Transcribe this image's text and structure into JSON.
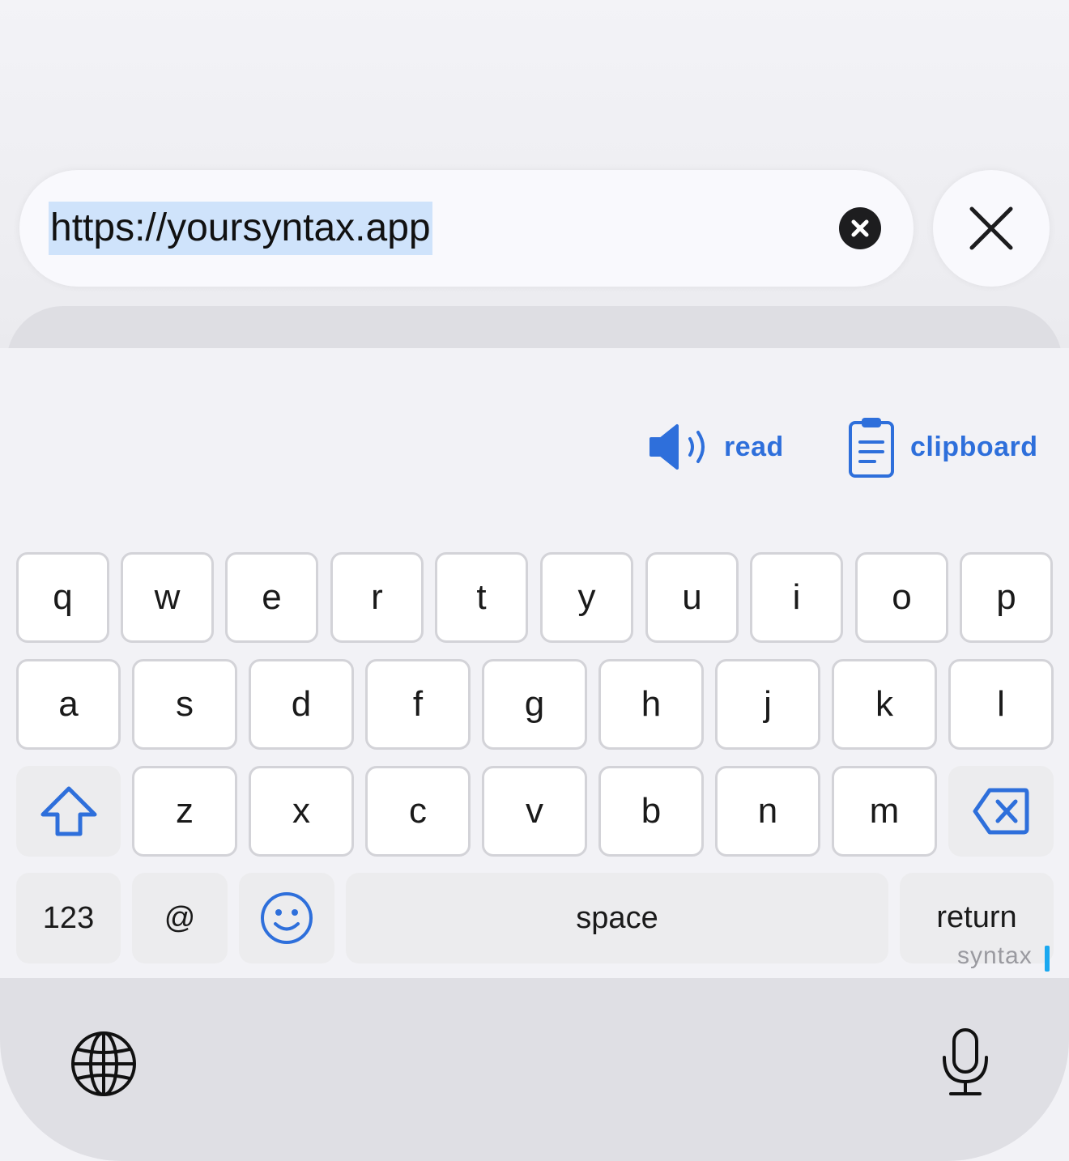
{
  "url_bar": {
    "text": "https://yoursyntax.app",
    "clear_icon": "xmark-circle-fill-icon",
    "close_icon": "xmark-icon"
  },
  "toolbar": {
    "read_label": "read",
    "read_icon": "speaker-wave-icon",
    "clipboard_label": "clipboard",
    "clipboard_icon": "clipboard-icon"
  },
  "keyboard": {
    "row1": [
      "q",
      "w",
      "e",
      "r",
      "t",
      "y",
      "u",
      "i",
      "o",
      "p"
    ],
    "row2": [
      "a",
      "s",
      "d",
      "f",
      "g",
      "h",
      "j",
      "k",
      "l"
    ],
    "row3": [
      "z",
      "x",
      "c",
      "v",
      "b",
      "n",
      "m"
    ],
    "numbers_label": "123",
    "at_label": "@",
    "space_label": "space",
    "return_label": "return",
    "return_sublabel": "syntax",
    "shift_icon": "shift-icon",
    "delete_icon": "delete-left-icon",
    "emoji_icon": "smiley-icon",
    "globe_icon": "globe-icon",
    "mic_icon": "microphone-icon"
  },
  "colors": {
    "accent": "#2e6fdb",
    "selection": "#cfe3fb",
    "cursor": "#1aa8f0"
  }
}
